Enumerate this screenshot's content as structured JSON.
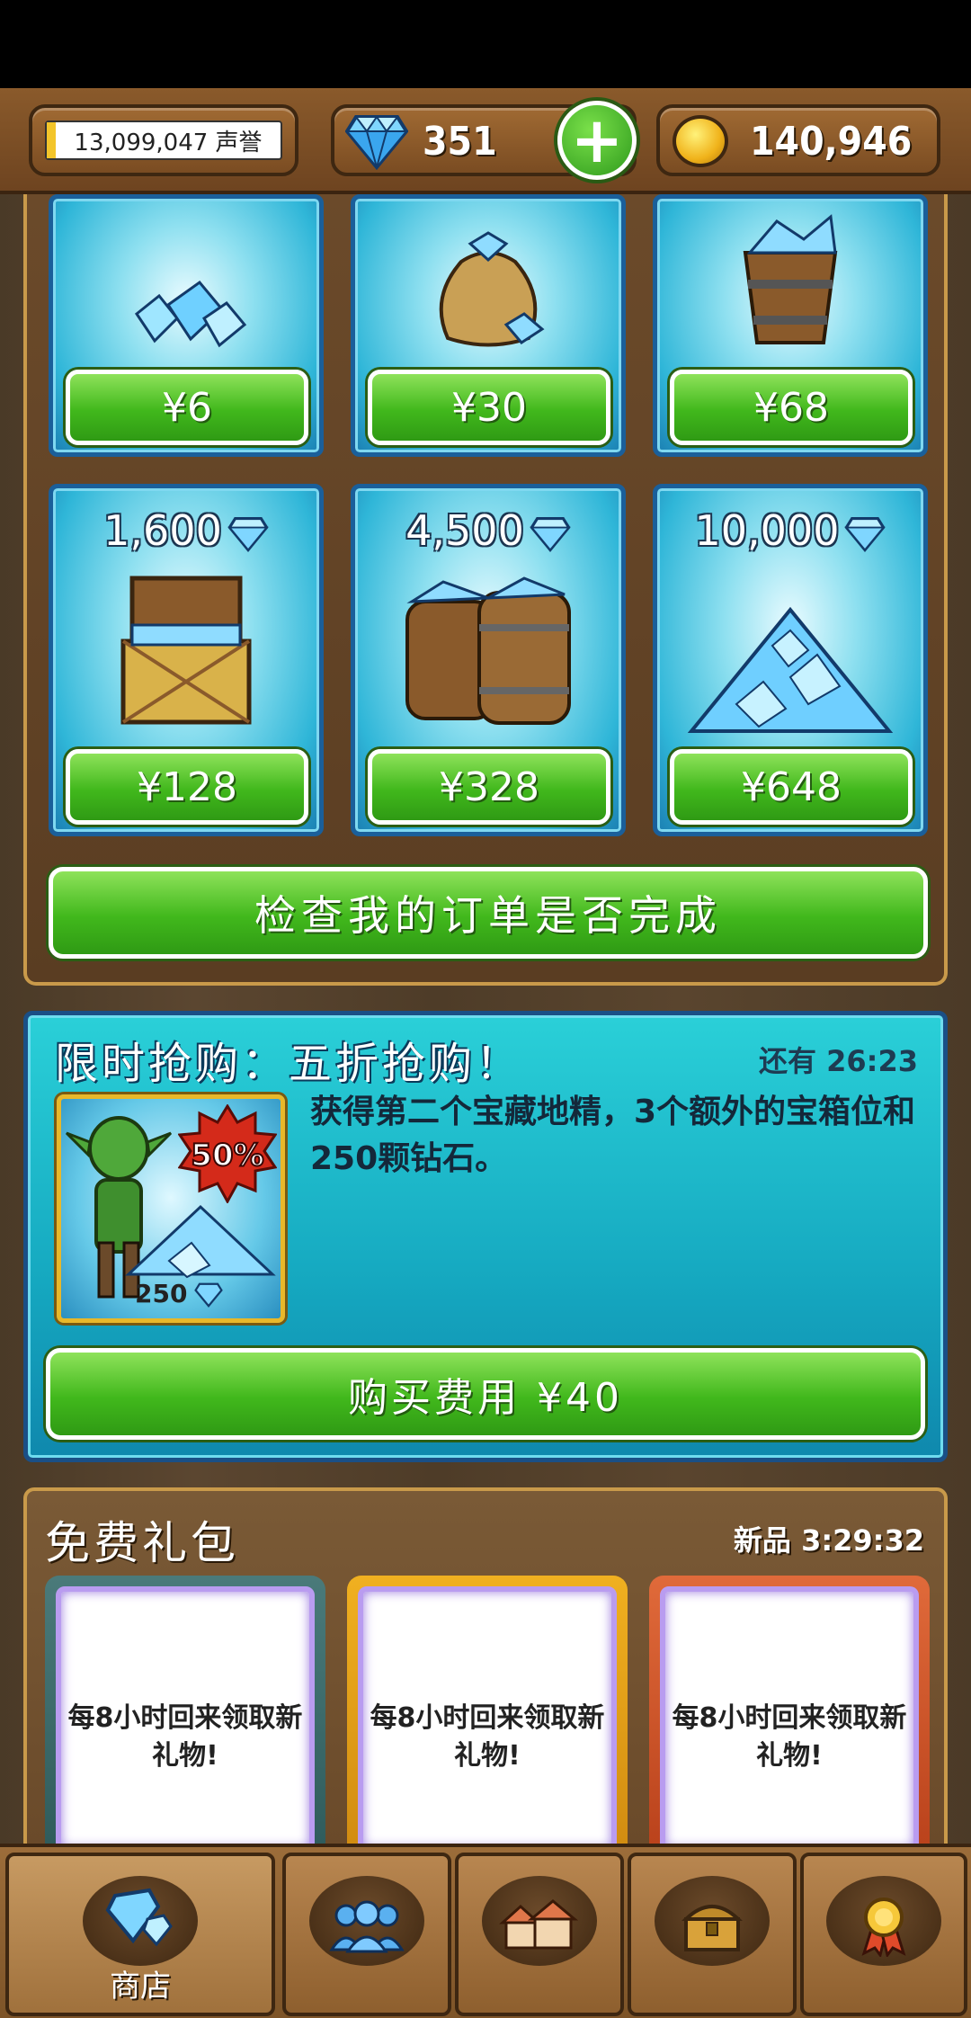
{
  "topbar": {
    "reputation": "13,099,047 声誉",
    "gems": "351",
    "gold": "140,946"
  },
  "store": {
    "packs": [
      {
        "title": "",
        "price": "¥6"
      },
      {
        "title": "",
        "price": "¥30"
      },
      {
        "title": "",
        "price": "¥68"
      },
      {
        "title": "1,600",
        "price": "¥128"
      },
      {
        "title": "4,500",
        "price": "¥328"
      },
      {
        "title": "10,000",
        "price": "¥648"
      }
    ],
    "check_orders": "检查我的订单是否完成"
  },
  "flash_sale": {
    "title": "限时抢购：五折抢购！",
    "timer": "还有 26:23",
    "badge": "50%",
    "gem_count": "250",
    "description": "获得第二个宝藏地精，3个额外的宝箱位和250颗钻石。",
    "buy_label": "购买费用 ¥40"
  },
  "free_gift": {
    "title": "免费礼包",
    "timer": "新品 3:29:32",
    "cards": [
      {
        "text": "每8小时回来领取新礼物!"
      },
      {
        "text": "每8小时回来领取新礼物!"
      },
      {
        "text": "每8小时回来领取新礼物!"
      }
    ]
  },
  "nav": {
    "shop_label": "商店",
    "tabs": [
      "shop",
      "friends",
      "village",
      "chest",
      "achievements"
    ]
  },
  "colors": {
    "button_green": "#41b81c",
    "pack_blue": "#2fb6d8",
    "sale_cyan": "#15a8c0",
    "wood": "#7a5a36"
  }
}
